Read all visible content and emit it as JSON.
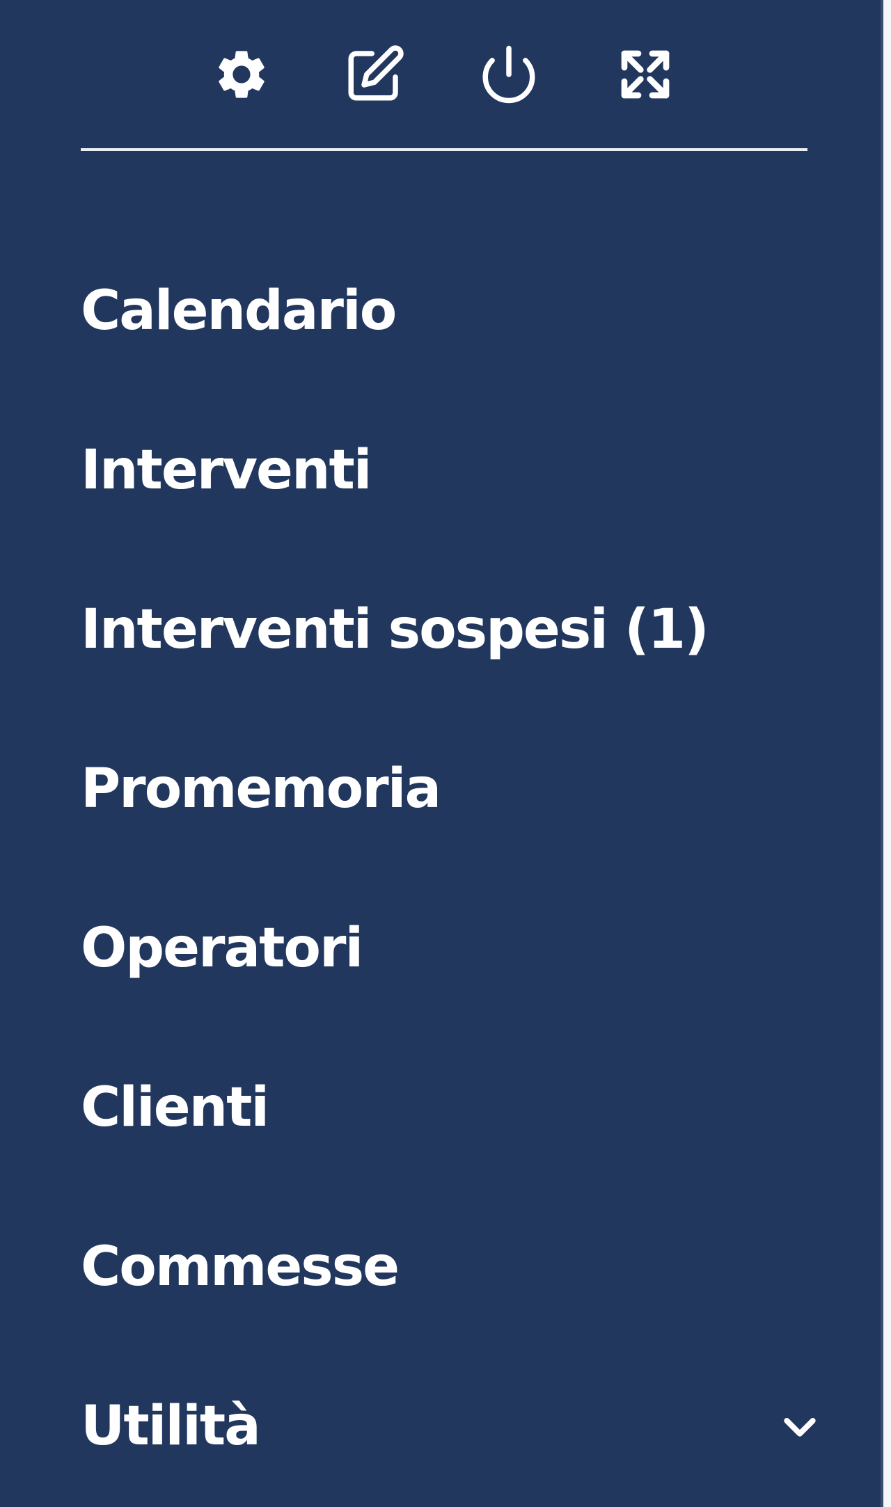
{
  "toolbar": {
    "icons": [
      "gear-icon",
      "edit-icon",
      "power-icon",
      "fullscreen-icon"
    ]
  },
  "menu": {
    "items": [
      {
        "label": "Calendario"
      },
      {
        "label": "Interventi"
      },
      {
        "label": "Interventi sospesi (1)"
      },
      {
        "label": "Promemoria"
      },
      {
        "label": "Operatori"
      },
      {
        "label": "Clienti"
      },
      {
        "label": "Commesse"
      },
      {
        "label": "Utilità",
        "icon": "chevron-down-icon"
      }
    ]
  },
  "colors": {
    "sidebar_bg": "#22375e",
    "text": "#ffffff"
  }
}
